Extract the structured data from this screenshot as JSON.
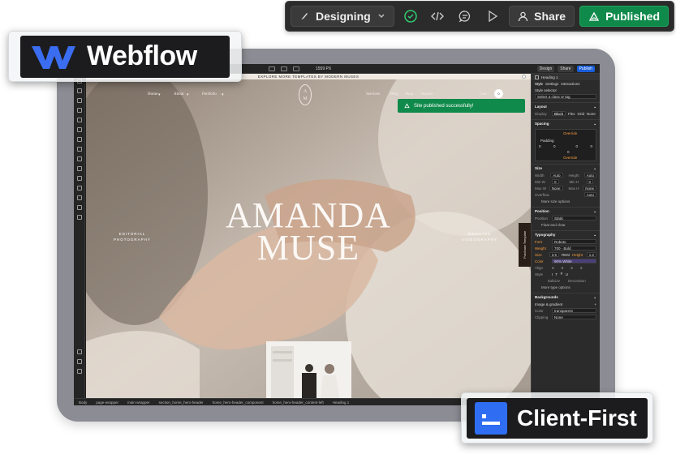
{
  "toolbar": {
    "mode_label": "Designing",
    "share_label": "Share",
    "publish_label": "Published"
  },
  "logo": {
    "brand": "Webflow"
  },
  "designer": {
    "canvas_width": "1559 PX",
    "mode_label": "Design",
    "share_label": "Share",
    "publish_label": "Publish"
  },
  "site": {
    "banner": "EXPLORE MORE TEMPLATES BY MODERN MUSES",
    "nav_left": [
      "Home",
      "About",
      "Portfolio"
    ],
    "nav_right": [
      "Services",
      "Blog",
      "Shop",
      "Inquire",
      "Cart"
    ],
    "cart_count": "0",
    "monogram": [
      "A",
      "M"
    ],
    "hero_line1": "AMANDA",
    "hero_line2": "MUSE",
    "left_caption": [
      "EDITORIAL",
      "PHOTOGRAPHY"
    ],
    "right_caption": [
      "WEDDING",
      "VIDEOGRAPHY"
    ],
    "purchase_tab": "Purchase Template"
  },
  "toast": {
    "message": "Site published successfully!"
  },
  "panel": {
    "element": "Heading 1",
    "tabs": [
      "Style",
      "Settings",
      "Interactions"
    ],
    "selector_label": "Style selector",
    "selector_placeholder": "Select a class or tag",
    "layout": {
      "title": "Layout",
      "display_label": "Display",
      "options": [
        "Block",
        "Flex",
        "Grid",
        "None"
      ]
    },
    "spacing": {
      "title": "Spacing",
      "margin_label": "Override",
      "padding_label": "Padding",
      "value": "0"
    },
    "size": {
      "title": "Size",
      "width_label": "Width",
      "width": "Auto",
      "height_label": "Height",
      "height": "Auto",
      "minw_label": "Min W",
      "minw": "0",
      "minh_label": "Min H",
      "minh": "0",
      "maxw_label": "Max W",
      "maxw": "None",
      "maxh_label": "Max H",
      "maxh": "None",
      "overflow_label": "Overflow",
      "overflow": "Auto",
      "more": "More size options"
    },
    "position": {
      "title": "Position",
      "label": "Position",
      "value": "Static",
      "float": "Float and clear"
    },
    "typography": {
      "title": "Typography",
      "font_label": "Font",
      "font": "Roboto",
      "weight_label": "Weight",
      "weight": "700 - Bold",
      "size_label": "Size",
      "size": "3.5",
      "size_unit": "REM",
      "height_label": "Height",
      "height": "1.2",
      "color_label": "Color",
      "color": "90% White",
      "align_label": "Align",
      "style_label": "Style",
      "italicize": "Italicize",
      "decoration": "Decoration",
      "more": "More type options"
    },
    "backgrounds": {
      "title": "Backgrounds",
      "image_label": "Image & gradient",
      "color_label": "Color",
      "color": "transparent",
      "clipping_label": "Clipping",
      "clipping": "None"
    }
  },
  "breadcrumb": [
    "Body",
    "page-wrapper",
    "main-wrapper",
    "section_home_hero-header",
    "home_hero-header_component",
    "home_hero-header_content-left",
    "Heading 1"
  ],
  "badge": {
    "label": "Client-First"
  },
  "colors": {
    "publish_green": "#0f8a4a",
    "accent_blue": "#2f6ef2",
    "device_frame": "#8c8c94"
  }
}
